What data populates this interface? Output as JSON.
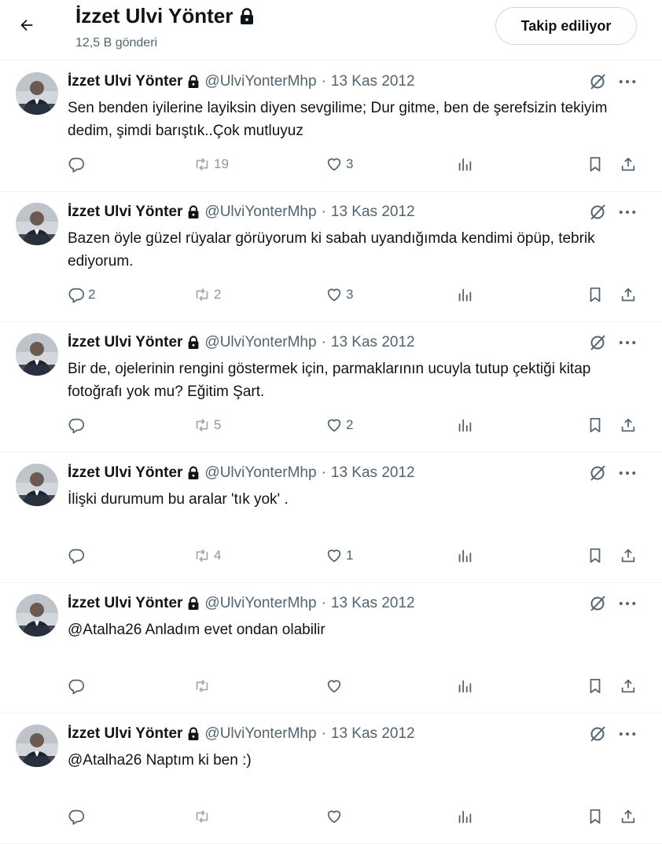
{
  "header": {
    "title": "İzzet Ulvi Yönter",
    "post_count": "12,5 B gönderi",
    "follow_label": "Takip ediliyor"
  },
  "tweets": [
    {
      "name": "İzzet Ulvi Yönter",
      "handle": "@UlviYonterMhp",
      "dot": "·",
      "date": "13 Kas 2012",
      "text": "Sen benden iyilerine layiksin diyen sevgilime; Dur gitme, ben de şerefsizin tekiyim dedim, şimdi barıştık..Çok mutluyuz",
      "replies": "",
      "retweets": "19",
      "likes": "3"
    },
    {
      "name": "İzzet Ulvi Yönter",
      "handle": "@UlviYonterMhp",
      "dot": "·",
      "date": "13 Kas 2012",
      "text": "Bazen öyle güzel rüyalar görüyorum ki sabah uyandığımda kendimi öpüp, tebrik ediyorum.",
      "replies": "2",
      "retweets": "2",
      "likes": "3"
    },
    {
      "name": "İzzet Ulvi Yönter",
      "handle": "@UlviYonterMhp",
      "dot": "·",
      "date": "13 Kas 2012",
      "text": "Bir de, ojelerinin rengini göstermek için, parmaklarının ucuyla tutup çektiği kitap fotoğrafı yok mu? Eğitim Şart.",
      "replies": "",
      "retweets": "5",
      "likes": "2"
    },
    {
      "name": "İzzet Ulvi Yönter",
      "handle": "@UlviYonterMhp",
      "dot": "·",
      "date": "13 Kas 2012",
      "text": "İlişki durumum bu aralar 'tık yok' .",
      "replies": "",
      "retweets": "4",
      "likes": "1"
    },
    {
      "name": "İzzet Ulvi Yönter",
      "handle": "@UlviYonterMhp",
      "dot": "·",
      "date": "13 Kas 2012",
      "text": "@Atalha26 Anladım evet ondan olabilir",
      "replies": "",
      "retweets": "",
      "likes": ""
    },
    {
      "name": "İzzet Ulvi Yönter",
      "handle": "@UlviYonterMhp",
      "dot": "·",
      "date": "13 Kas 2012",
      "text": "@Atalha26 Naptım ki ben :)",
      "replies": "",
      "retweets": "",
      "likes": ""
    }
  ],
  "icons": {
    "back": "arrow-left-icon",
    "lock": "lock-icon",
    "grok": "grok-icon",
    "more": "more-icon",
    "reply": "reply-icon",
    "retweet": "retweet-icon",
    "like": "heart-icon",
    "views": "views-icon",
    "bookmark": "bookmark-icon",
    "share": "share-icon"
  },
  "colors": {
    "text": "#0f1419",
    "secondary": "#536471",
    "border": "#eff3f4"
  }
}
